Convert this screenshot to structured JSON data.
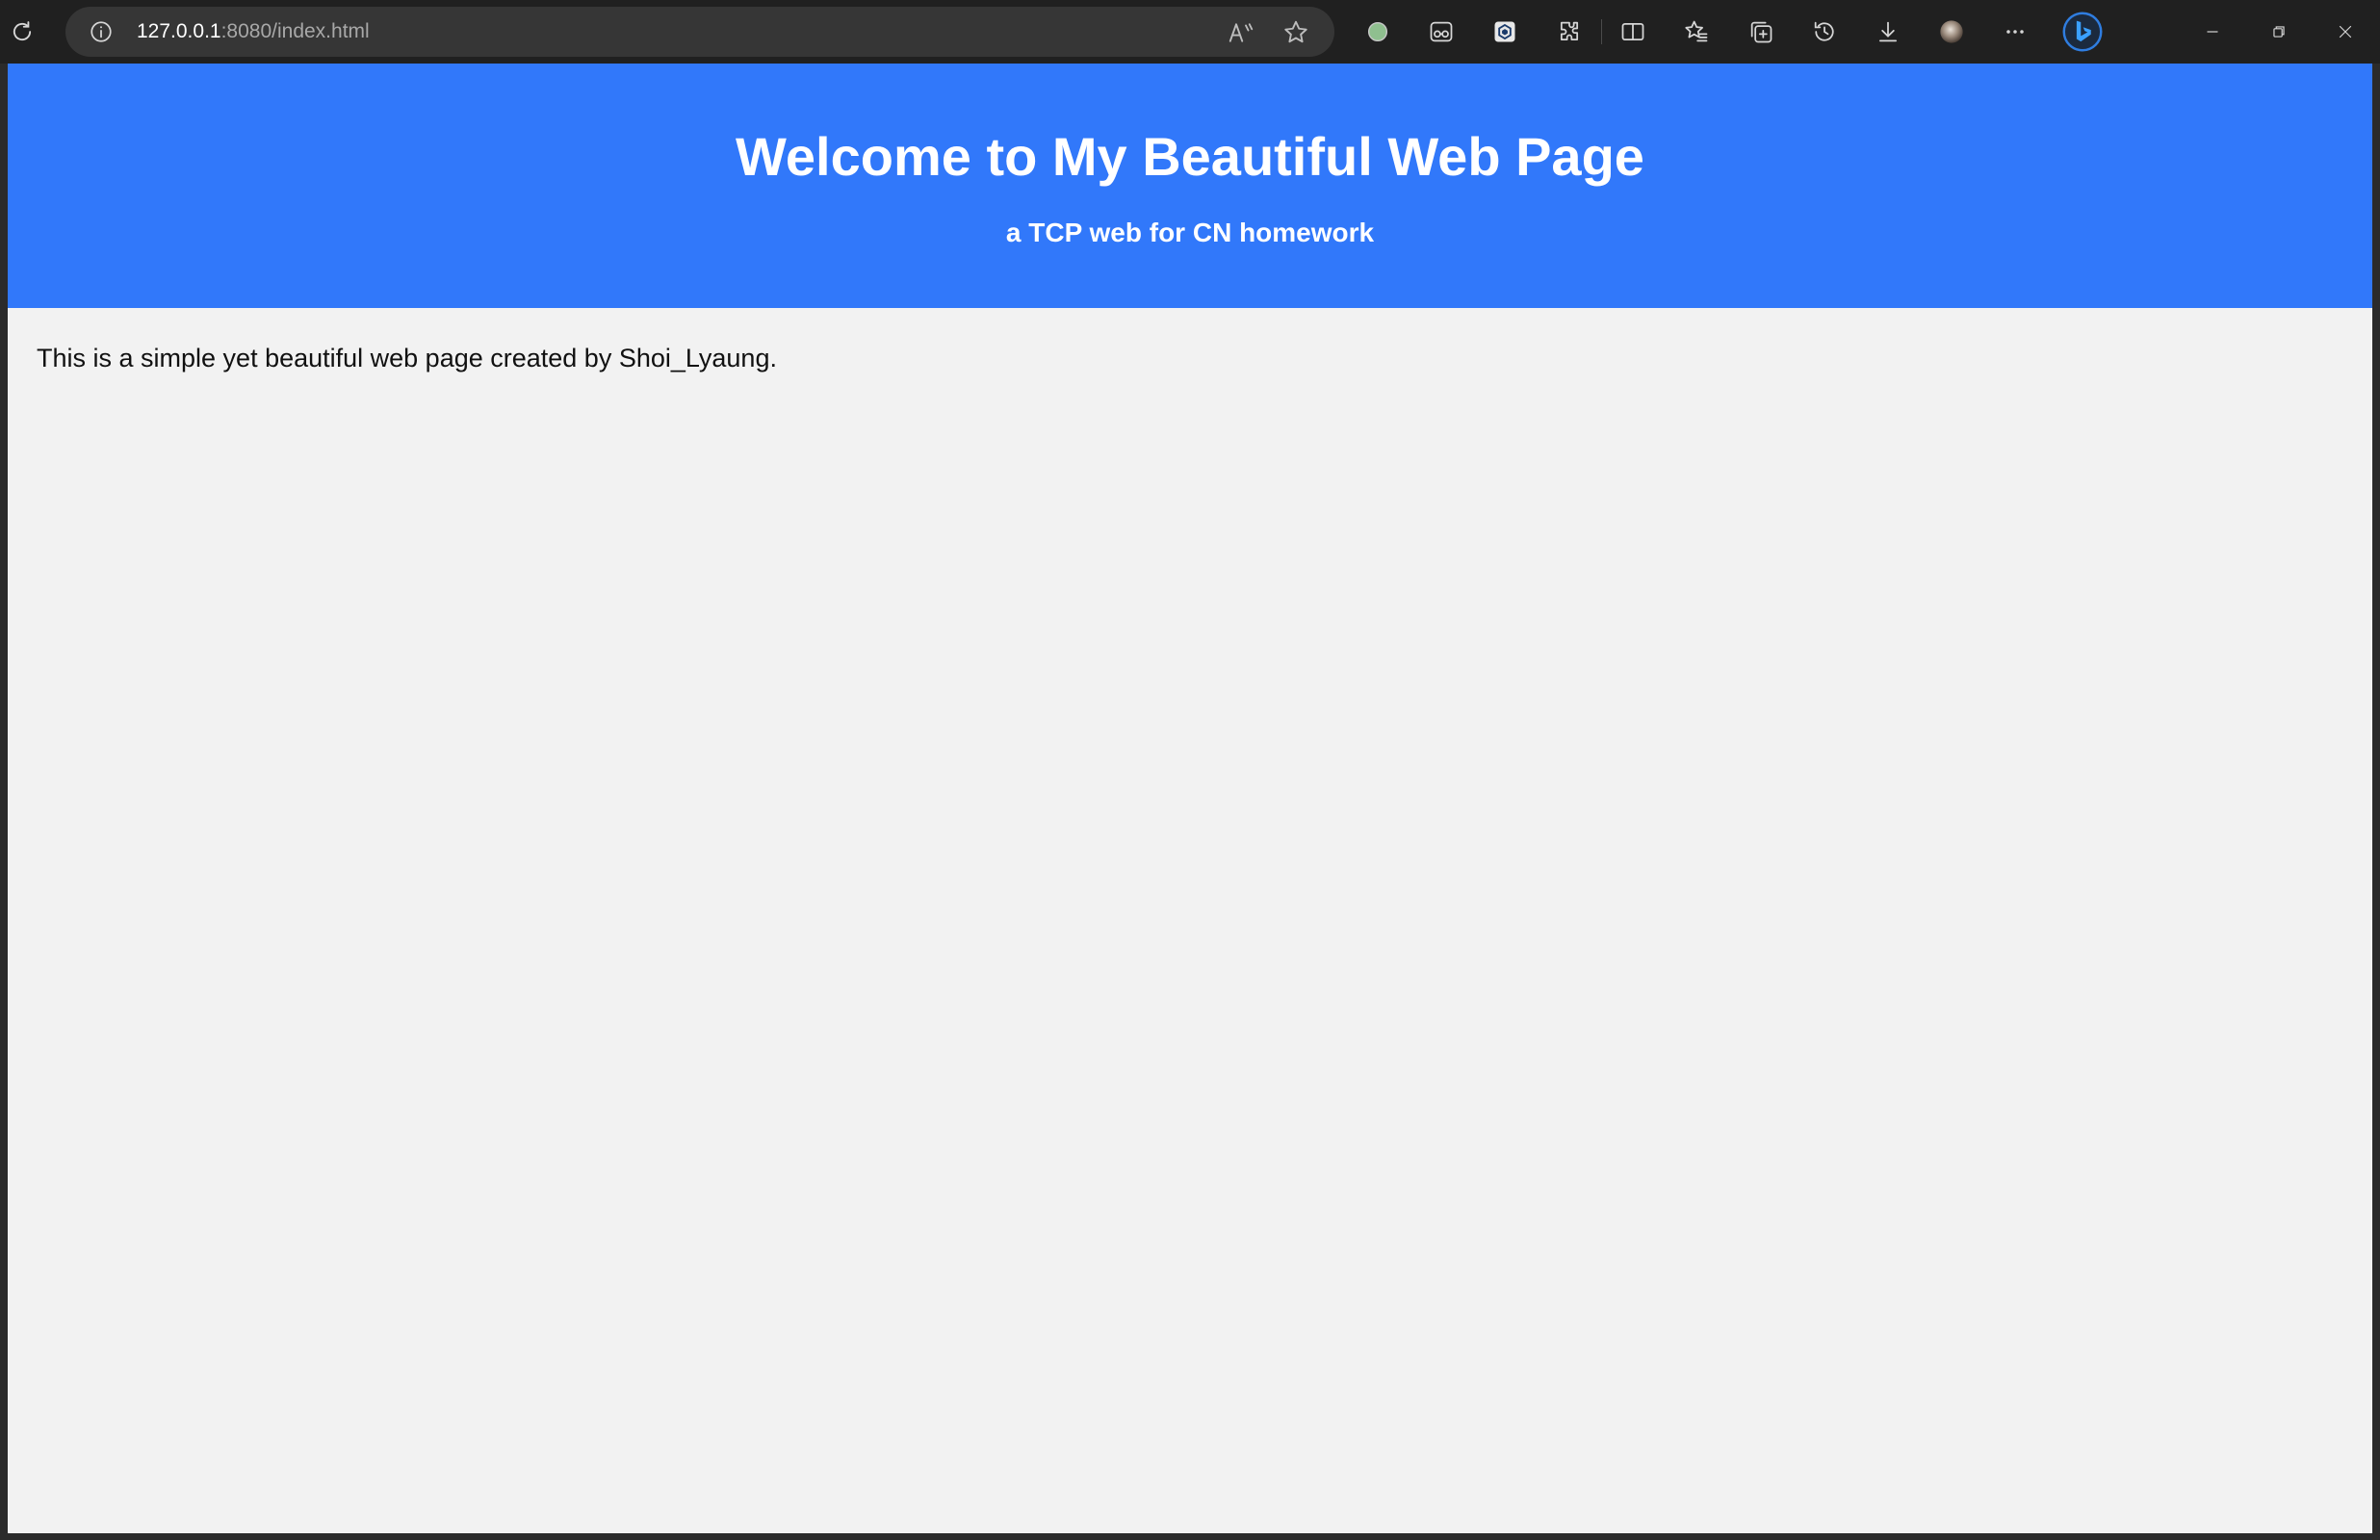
{
  "browser": {
    "url_host": "127.0.0.1",
    "url_path": ":8080/index.html"
  },
  "page": {
    "title": "Welcome to My Beautiful Web Page",
    "subtitle": "a TCP web for CN homework",
    "body_text": "This is a simple yet beautiful web page created by Shoi_Lyaung."
  },
  "colors": {
    "header_bg": "#3178fa",
    "page_bg": "#f2f2f2",
    "toolbar_bg": "#202020",
    "address_bg": "#363636"
  },
  "icons": {
    "toolbar": [
      "refresh-icon",
      "site-info-icon",
      "read-aloud-icon",
      "favorite-star-icon",
      "extension-green-dot-icon",
      "extension-glasses-icon",
      "extension-box-icon",
      "extensions-puzzle-icon",
      "split-screen-icon",
      "favorites-icon",
      "collections-icon",
      "history-icon",
      "downloads-icon",
      "profile-avatar",
      "more-options-icon",
      "bing-copilot-icon"
    ],
    "window": [
      "minimize-icon",
      "restore-icon",
      "close-icon"
    ]
  }
}
